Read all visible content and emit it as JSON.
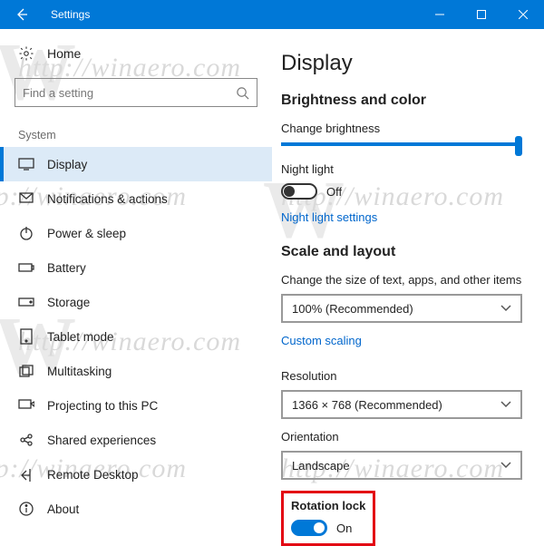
{
  "titlebar": {
    "title": "Settings"
  },
  "sidebar": {
    "home": "Home",
    "search_placeholder": "Find a setting",
    "section": "System",
    "items": [
      {
        "label": "Display"
      },
      {
        "label": "Notifications & actions"
      },
      {
        "label": "Power & sleep"
      },
      {
        "label": "Battery"
      },
      {
        "label": "Storage"
      },
      {
        "label": "Tablet mode"
      },
      {
        "label": "Multitasking"
      },
      {
        "label": "Projecting to this PC"
      },
      {
        "label": "Shared experiences"
      },
      {
        "label": "Remote Desktop"
      },
      {
        "label": "About"
      }
    ]
  },
  "main": {
    "title": "Display",
    "section_brightness": "Brightness and color",
    "brightness_label": "Change brightness",
    "nightlight_label": "Night light",
    "nightlight_state": "Off",
    "nightlight_link": "Night light settings",
    "section_scale": "Scale and layout",
    "scale_label": "Change the size of text, apps, and other items",
    "scale_value": "100% (Recommended)",
    "custom_scaling_link": "Custom scaling",
    "resolution_label": "Resolution",
    "resolution_value": "1366 × 768 (Recommended)",
    "orientation_label": "Orientation",
    "orientation_value": "Landscape",
    "rotation_label": "Rotation lock",
    "rotation_state": "On"
  },
  "watermark": "http://winaero.com"
}
